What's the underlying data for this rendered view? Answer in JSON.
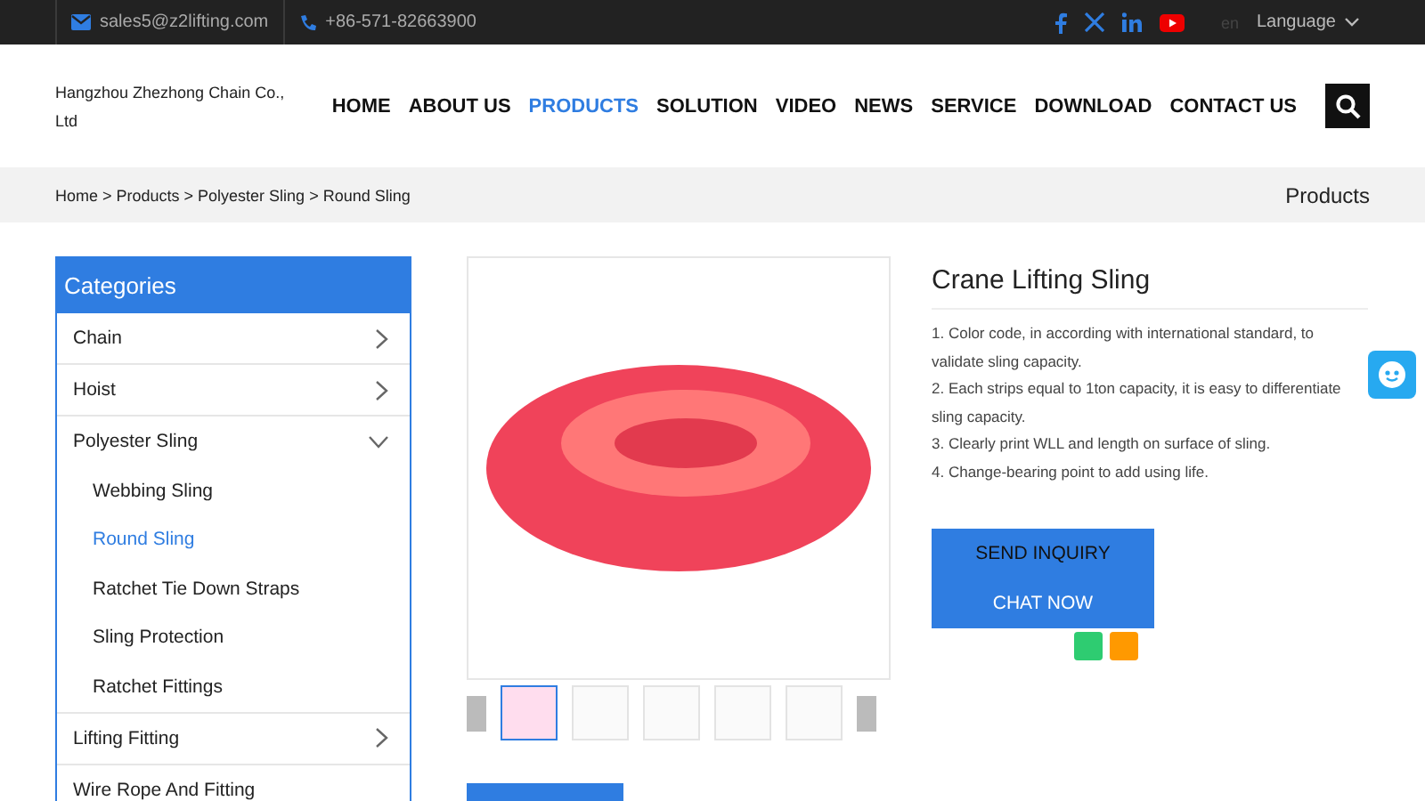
{
  "top_bar": {
    "email": "sales5@z2lifting.com",
    "phone": "+86-571-82663900",
    "language_code": "en",
    "language": "Language"
  },
  "header": {
    "company": "Hangzhou Zhezhong Chain Co., Ltd",
    "nav": [
      {
        "label": "HOME",
        "selected": false
      },
      {
        "label": "ABOUT US",
        "selected": false
      },
      {
        "label": "PRODUCTS",
        "selected": true
      },
      {
        "label": "SOLUTION",
        "selected": false
      },
      {
        "label": "VIDEO",
        "selected": false
      },
      {
        "label": "NEWS",
        "selected": false
      },
      {
        "label": "SERVICE",
        "selected": false
      },
      {
        "label": "DOWNLOAD",
        "selected": false
      },
      {
        "label": "CONTACT US",
        "selected": false
      }
    ]
  },
  "breadcrumb": {
    "path": "Home > Products > Polyester Sling > Round Sling",
    "section": "Products"
  },
  "sidebar": {
    "title": "Categories",
    "items": [
      {
        "label": "Chain",
        "expanded": false
      },
      {
        "label": "Hoist",
        "expanded": false
      },
      {
        "label": "Polyester Sling",
        "expanded": true,
        "children": [
          {
            "label": "Webbing Sling",
            "selected": false
          },
          {
            "label": "Round Sling",
            "selected": true
          },
          {
            "label": "Ratchet Tie Down Straps",
            "selected": false
          },
          {
            "label": "Sling Protection",
            "selected": false
          },
          {
            "label": "Ratchet Fittings",
            "selected": false
          }
        ]
      },
      {
        "label": "Lifting Fitting",
        "expanded": false
      },
      {
        "label": "Wire Rope And Fitting"
      }
    ]
  },
  "gallery": {
    "thumbnails": [
      {
        "selected": true
      },
      {
        "selected": false
      },
      {
        "selected": false
      },
      {
        "selected": false
      },
      {
        "selected": false
      }
    ]
  },
  "product": {
    "title": "Crane Lifting Sling",
    "features": [
      "1. Color code, in according with international standard, to validate sling capacity.",
      "2. Each strips equal to 1ton capacity, it is easy to differentiate sling capacity.",
      "3. Clearly print WLL and length on surface of sling.",
      "4. Change-bearing point to add using life."
    ],
    "buttons": [
      "SEND INQUIRY",
      "CHAT NOW"
    ]
  }
}
